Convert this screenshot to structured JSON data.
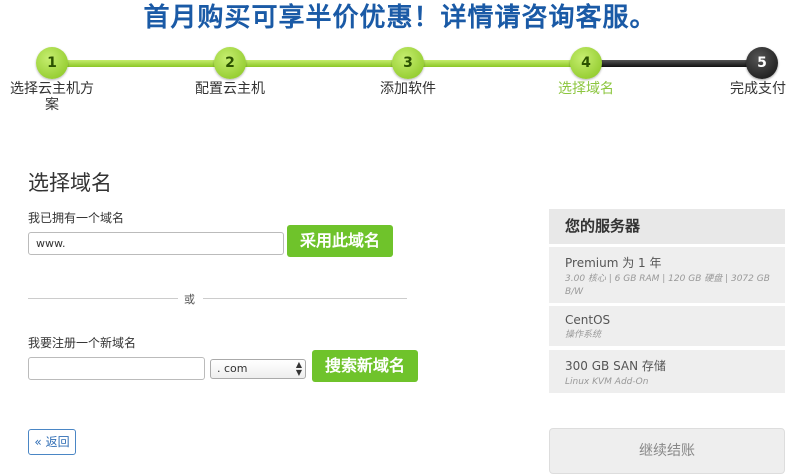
{
  "banner": "首月购买可享半价优惠！详情请咨询客服。",
  "steps": [
    {
      "num": "1",
      "label": "选择云主机方案"
    },
    {
      "num": "2",
      "label": "配置云主机"
    },
    {
      "num": "3",
      "label": "添加软件"
    },
    {
      "num": "4",
      "label": "选择域名"
    },
    {
      "num": "5",
      "label": "完成支付"
    }
  ],
  "current_step": 4,
  "section_title": "选择域名",
  "own_domain": {
    "label": "我已拥有一个域名",
    "value": "www.",
    "button": "采用此域名"
  },
  "divider_or": "或",
  "new_domain": {
    "label": "我要注册一个新域名",
    "value": "",
    "tld": ". com",
    "button": "搜索新域名"
  },
  "back_button": "« 返回",
  "server_panel": {
    "title": "您的服务器",
    "plan_line": "Premium 为 1 年",
    "plan_specs": "3.00 核心 | 6 GB RAM | 120 GB 硬盘 | 3072 GB B/W",
    "os_name": "CentOS",
    "os_label": "操作系统",
    "storage": "300 GB SAN 存储",
    "storage_sub": "Linux KVM Add-On"
  },
  "checkout_button": "继续结账",
  "colors": {
    "accent_green": "#6fc32b",
    "banner_blue": "#1a5aa6",
    "link_blue": "#2f6db5"
  }
}
